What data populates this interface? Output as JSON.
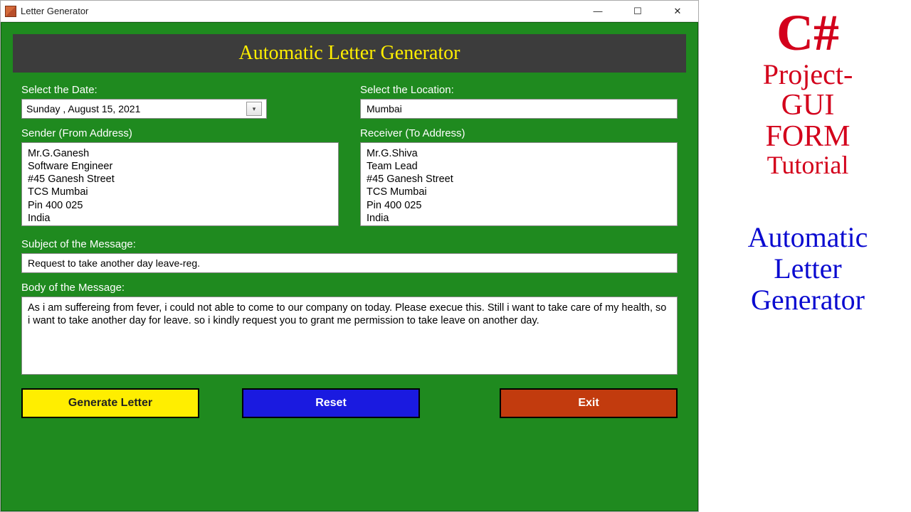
{
  "window": {
    "title": "Letter Generator"
  },
  "header": {
    "title": "Automatic Letter Generator"
  },
  "labels": {
    "date": "Select the Date:",
    "location": "Select the Location:",
    "sender": "Sender (From Address)",
    "receiver": "Receiver (To Address)",
    "subject": "Subject of the Message:",
    "body": "Body of the Message:"
  },
  "fields": {
    "date": "Sunday    ,    August    15, 2021",
    "location": "Mumbai",
    "sender": "Mr.G.Ganesh\nSoftware Engineer\n#45 Ganesh Street\nTCS Mumbai\nPin 400 025\nIndia",
    "receiver": "Mr.G.Shiva\nTeam Lead\n#45 Ganesh Street\nTCS Mumbai\nPin 400 025\nIndia",
    "subject": "Request to take another day leave-reg.",
    "body": "As i am suffereing from fever, i could not able to come to our company on today. Please execue this. Still i want to take care of my health, so i want to take another day for leave. so i kindly request you to grant me permission to take leave on another day."
  },
  "buttons": {
    "generate": "Generate Letter",
    "reset": "Reset",
    "exit": "Exit"
  },
  "promo": {
    "line1": "C#",
    "line2": "Project-",
    "line3": "GUI",
    "line4": "FORM",
    "line5": "Tutorial",
    "blue1": "Automatic",
    "blue2": "Letter",
    "blue3": "Generator"
  },
  "colors": {
    "formBg": "#1f8a1f",
    "headerBg": "#3c3c3c",
    "headerText": "#ffee00",
    "btnGenerate": "#ffee00",
    "btnReset": "#1a1ae0",
    "btnExit": "#c23b0e",
    "promoRed": "#d3001b",
    "promoBlue": "#0a0ad0"
  }
}
